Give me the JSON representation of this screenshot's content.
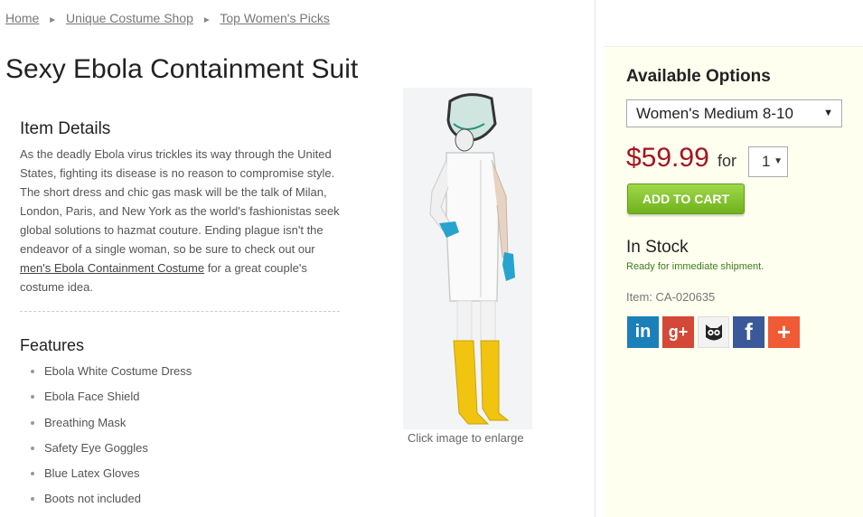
{
  "breadcrumb": {
    "items": [
      "Home",
      "Unique Costume Shop",
      "Top Women's Picks"
    ]
  },
  "product": {
    "title": "Sexy Ebola Containment Suit",
    "image_caption": "Click image to enlarge"
  },
  "details": {
    "heading": "Item Details",
    "text_before_link": "As the deadly Ebola virus trickles its way through the United States, fighting its disease is no reason to compromise style. The short dress and chic gas mask will be the talk of Milan, London, Paris, and New York as the world's fashionistas seek global solutions to hazmat couture. Ending plague isn't the endeavor of a single woman, so be sure to check out our ",
    "link_text": "men's Ebola Containment Costume",
    "text_after_link": " for a great couple's costume idea."
  },
  "features": {
    "heading": "Features",
    "items": [
      "Ebola White Costume Dress",
      "Ebola Face Shield",
      "Breathing Mask",
      "Safety Eye Goggles",
      "Blue Latex Gloves",
      "Boots not included"
    ]
  },
  "options": {
    "heading": "Available Options",
    "size_selected": "Women's Medium 8-10",
    "price": "$59.99",
    "for_label": "for",
    "quantity": "1",
    "add_to_cart": "ADD TO CART",
    "stock_status": "In Stock",
    "shipment_note": "Ready for immediate shipment.",
    "item_code": "Item: CA-020635"
  },
  "social": {
    "icons": [
      "linkedin-icon",
      "google-plus-icon",
      "hootsuite-icon",
      "facebook-icon",
      "addthis-icon"
    ],
    "labels": [
      "in",
      "g+",
      "",
      "f",
      "+"
    ]
  },
  "colors": {
    "price": "#a5131e",
    "add_to_cart": "#7cbf25",
    "in_stock_note": "#3a7d1d",
    "panel_background": "#fffff0"
  }
}
